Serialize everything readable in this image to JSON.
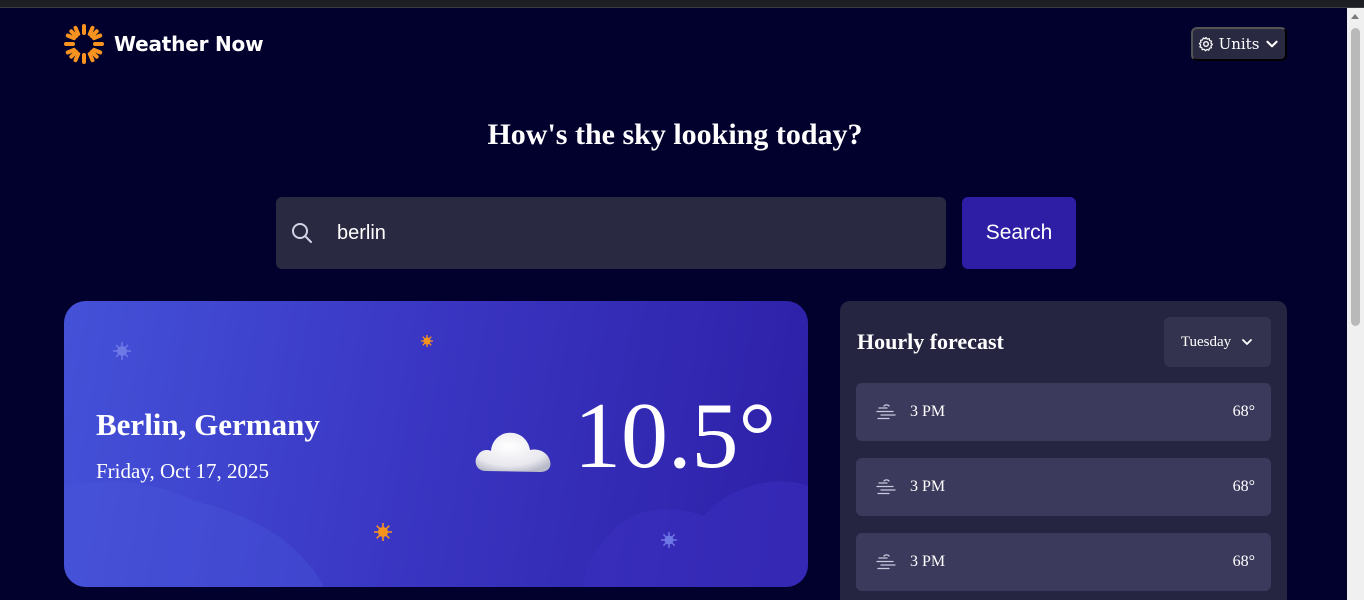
{
  "app": {
    "name": "Weather Now",
    "units_label": "Units"
  },
  "headline": "How's the sky looking today?",
  "search": {
    "value": "berlin",
    "button_label": "Search"
  },
  "current": {
    "location": "Berlin, Germany",
    "date": "Friday, Oct 17, 2025",
    "temperature": "10.5°",
    "condition_icon": "cloud-icon"
  },
  "hourly": {
    "title": "Hourly forecast",
    "selected_day": "Tuesday",
    "items": [
      {
        "time": "3 PM",
        "temp": "68°",
        "icon": "fog-icon"
      },
      {
        "time": "3 PM",
        "temp": "68°",
        "icon": "fog-icon"
      },
      {
        "time": "3 PM",
        "temp": "68°",
        "icon": "fog-icon"
      }
    ]
  },
  "colors": {
    "page_bg": "#02012e",
    "accent_button": "#2e1ea6",
    "panel": "#262541",
    "logo_orange": "#f7931e"
  }
}
